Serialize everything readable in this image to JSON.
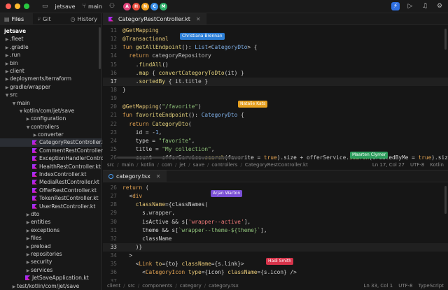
{
  "titlebar": {
    "project": "jetsave",
    "branch": "main",
    "avatars": [
      {
        "letter": "A",
        "color": "#e0437a"
      },
      {
        "letter": "H",
        "color": "#e64a3a"
      },
      {
        "letter": "N",
        "color": "#f0a020"
      },
      {
        "letter": "C",
        "color": "#3a8ee6"
      },
      {
        "letter": "M",
        "color": "#2fae6a"
      }
    ]
  },
  "sidebar": {
    "tabs": [
      {
        "label": "Files",
        "icon": "folder-icon"
      },
      {
        "label": "Git",
        "icon": "git-icon"
      },
      {
        "label": "History",
        "icon": "clock-icon"
      }
    ],
    "tree": [
      {
        "label": "jetsave",
        "depth": 0,
        "type": "root"
      },
      {
        "label": ".fleet",
        "depth": 0,
        "type": "dir"
      },
      {
        "label": ".gradle",
        "depth": 0,
        "type": "dir"
      },
      {
        "label": ".run",
        "depth": 0,
        "type": "dir"
      },
      {
        "label": "bin",
        "depth": 0,
        "type": "dir"
      },
      {
        "label": "client",
        "depth": 0,
        "type": "dir"
      },
      {
        "label": "deployments/terraform",
        "depth": 0,
        "type": "dir"
      },
      {
        "label": "gradle/wrapper",
        "depth": 0,
        "type": "dir"
      },
      {
        "label": "src",
        "depth": 0,
        "type": "open"
      },
      {
        "label": "main",
        "depth": 1,
        "type": "open"
      },
      {
        "label": "kotlin/com/jet/save",
        "depth": 2,
        "type": "open"
      },
      {
        "label": "configuration",
        "depth": 3,
        "type": "dir"
      },
      {
        "label": "controllers",
        "depth": 3,
        "type": "open"
      },
      {
        "label": "converter",
        "depth": 4,
        "type": "dir"
      },
      {
        "label": "CategoryRestController.kt",
        "depth": 4,
        "type": "kt",
        "selected": true
      },
      {
        "label": "CommentRestController.kt",
        "depth": 4,
        "type": "kt"
      },
      {
        "label": "ExceptionHandlerController",
        "depth": 4,
        "type": "kt"
      },
      {
        "label": "HealthRestController.kt",
        "depth": 4,
        "type": "kt"
      },
      {
        "label": "IndexController.kt",
        "depth": 4,
        "type": "kt"
      },
      {
        "label": "MediaRestController.kt",
        "depth": 4,
        "type": "kt"
      },
      {
        "label": "OfferRestController.kt",
        "depth": 4,
        "type": "kt"
      },
      {
        "label": "TokenRestController.kt",
        "depth": 4,
        "type": "kt"
      },
      {
        "label": "UserRestController.kt",
        "depth": 4,
        "type": "kt"
      },
      {
        "label": "dto",
        "depth": 3,
        "type": "dir"
      },
      {
        "label": "entities",
        "depth": 3,
        "type": "dir"
      },
      {
        "label": "exceptions",
        "depth": 3,
        "type": "dir"
      },
      {
        "label": "files",
        "depth": 3,
        "type": "dir"
      },
      {
        "label": "preload",
        "depth": 3,
        "type": "dir"
      },
      {
        "label": "repositories",
        "depth": 3,
        "type": "dir"
      },
      {
        "label": "security",
        "depth": 3,
        "type": "dir"
      },
      {
        "label": "services",
        "depth": 3,
        "type": "dir"
      },
      {
        "label": "JetSaveApplication.kt",
        "depth": 3,
        "type": "kt"
      },
      {
        "label": "test/kotlin/com/jet/save",
        "depth": 1,
        "type": "dir"
      }
    ]
  },
  "editor1": {
    "tab": "CategoryRestController.kt",
    "lines": [
      {
        "num": "11",
        "html": "<span class='at'>@GetMapping</span>"
      },
      {
        "num": "12",
        "html": "<span class='at'>@Transactional</span>"
      },
      {
        "num": "13",
        "html": "<span class='k'>fun</span> <span class='f'>getAllEndpoint</span>(): <span class='n'>List</span>&lt;<span class='n'>CategoryDto</span>&gt; {"
      },
      {
        "num": "14",
        "html": "  <span class='k'>return</span> <span class='a'>categoryRepository</span>"
      },
      {
        "num": "15",
        "html": "    .<span class='f'>findAll</span>()"
      },
      {
        "num": "16",
        "html": "    .<span class='f'>map</span> { <span class='f'>convertCategoryToDto</span>(it) }"
      },
      {
        "num": "17",
        "html": "    .<span class='f'>sortedBy</span> { it.<span class='a'>title</span> }",
        "current": true
      },
      {
        "num": "18",
        "html": "}"
      },
      {
        "num": "19",
        "html": ""
      },
      {
        "num": "20",
        "html": "<span class='at'>@GetMapping</span>(<span class='s'>\"/favorite\"</span>)"
      },
      {
        "num": "21",
        "html": "<span class='k'>fun</span> <span class='f'>favoriteEndpoint</span>(): <span class='n'>CategoryDto</span> {"
      },
      {
        "num": "22",
        "html": "  <span class='k'>return</span> <span class='f'>CategoryDto</span>("
      },
      {
        "num": "23",
        "html": "    id = -<span class='n'>1</span>,"
      },
      {
        "num": "24",
        "html": "    type = <span class='s'>\"favorite\"</span>,"
      },
      {
        "num": "25",
        "html": "    title = <span class='s'>\"My collection\"</span>,"
      },
      {
        "num": "26",
        "html": "    count = <span class='a'>offerService</span>.<span class='f'>search</span>(favorite = <span class='k'>true</span>).size + <span class='a'>offerService</span>.<span class='f'>search</span>(createdByMe = <span class='k'>true</span>).size,"
      },
      {
        "num": "27",
        "html": "  )"
      }
    ],
    "cursors": [
      {
        "name": "Christiana Brennan",
        "color": "#2d7fd6",
        "line": 1,
        "col": 82
      },
      {
        "name": "Natalie Kats",
        "color": "#e6a020",
        "line": 9,
        "col": 165
      },
      {
        "name": "Maarten Clymer",
        "color": "#2e9e5e",
        "line": 15,
        "col": 325
      }
    ],
    "breadcrumb": [
      "src",
      "main",
      "kotlin",
      "com",
      "jet",
      "save",
      "controllers",
      "CategoryRestController.kt"
    ],
    "position": "Ln 17, Col 27",
    "encoding": "UTF-8",
    "language": "Kotlin"
  },
  "editor2": {
    "tab": "category.tsx",
    "lines": [
      {
        "num": "26",
        "html": "<span class='k'>return</span> ("
      },
      {
        "num": "27",
        "html": "  &lt;<span class='tg'>div</span>"
      },
      {
        "num": "28",
        "html": "    <span class='at'>className</span>={classNames("
      },
      {
        "num": "29",
        "html": "      s.<span class='a'>wrapper</span>,"
      },
      {
        "num": "30",
        "html": "      isActive &amp;&amp; s[<span class='s2'>'wrapper--active'</span>],"
      },
      {
        "num": "31",
        "html": "      theme &amp;&amp; s[<span class='s'>`wrapper--theme-${theme}`</span>],"
      },
      {
        "num": "32",
        "html": "      className"
      },
      {
        "num": "33",
        "html": "    )}",
        "current": true
      },
      {
        "num": "34",
        "html": "  &gt;"
      },
      {
        "num": "35",
        "html": "    &lt;<span class='tg'>Link</span> <span class='at'>to</span>={to} <span class='at'>className</span>={s.link}&gt;"
      },
      {
        "num": "36",
        "html": "      &lt;<span class='tg'>CategoryIcon</span> <span class='at'>type</span>={icon} <span class='at'>className</span>={s.icon} /&gt;"
      },
      {
        "num": "37",
        "html": ""
      }
    ],
    "cursors": [
      {
        "name": "Arjan Warton",
        "color": "#7a4fd6",
        "line": 1,
        "col": 126
      },
      {
        "name": "Hadi Smith",
        "color": "#d6334a",
        "line": 9,
        "col": 205
      }
    ],
    "breadcrumb": [
      "client",
      "src",
      "components",
      "category",
      "category.tsx"
    ],
    "position": "Ln 33, Col 1",
    "encoding": "UTF-8",
    "language": "TypeScript"
  }
}
